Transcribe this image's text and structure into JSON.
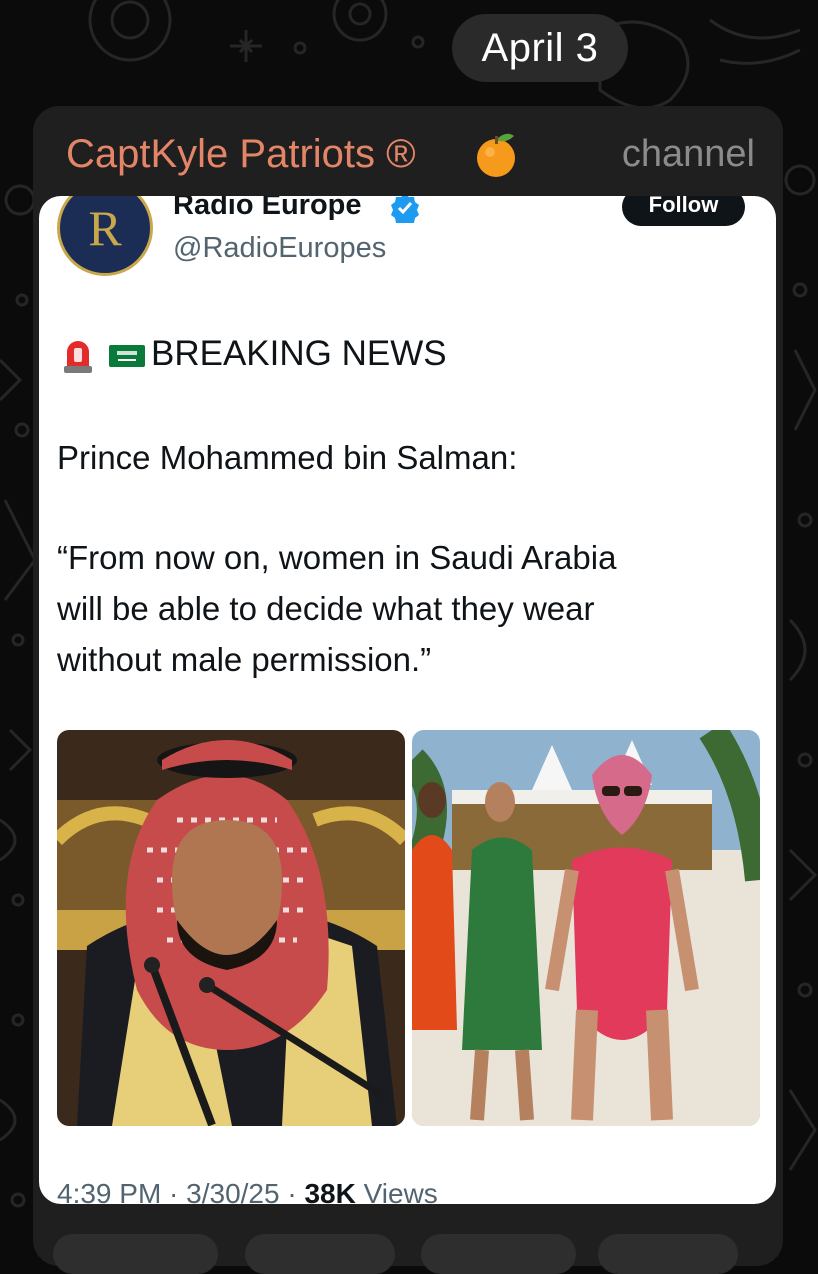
{
  "date_separator": "April 3",
  "channel": {
    "name": "CaptKyle Patriots ®",
    "label": "channel",
    "emoji_icon": "tangerine-emoji-icon"
  },
  "tweet": {
    "avatar_letter": "R",
    "author_name": "Radio Europe",
    "handle": "@RadioEuropes",
    "follow_label": "Follow",
    "headline": "BREAKING NEWS",
    "headline_icons": [
      "siren-emoji-icon",
      "saudi-flag-icon"
    ],
    "quote_lead": "Prince Mohammed bin Salman:",
    "quote_body": "“From now on, women in Saudi Arabia\nwill be able to decide what they wear\nwithout male permission.”",
    "meta": {
      "time_date": "4:39 PM · 3/30/25 · ",
      "views_count": "38K",
      "views_label": " Views"
    }
  },
  "colors": {
    "background": "#0b0b0b",
    "bubble": "#1f1f1f",
    "channel_name": "#e48568",
    "channel_label": "#8b8b8b",
    "card": "#ffffff",
    "verified": "#1d9bf0",
    "follow_button": "#0f1419"
  }
}
